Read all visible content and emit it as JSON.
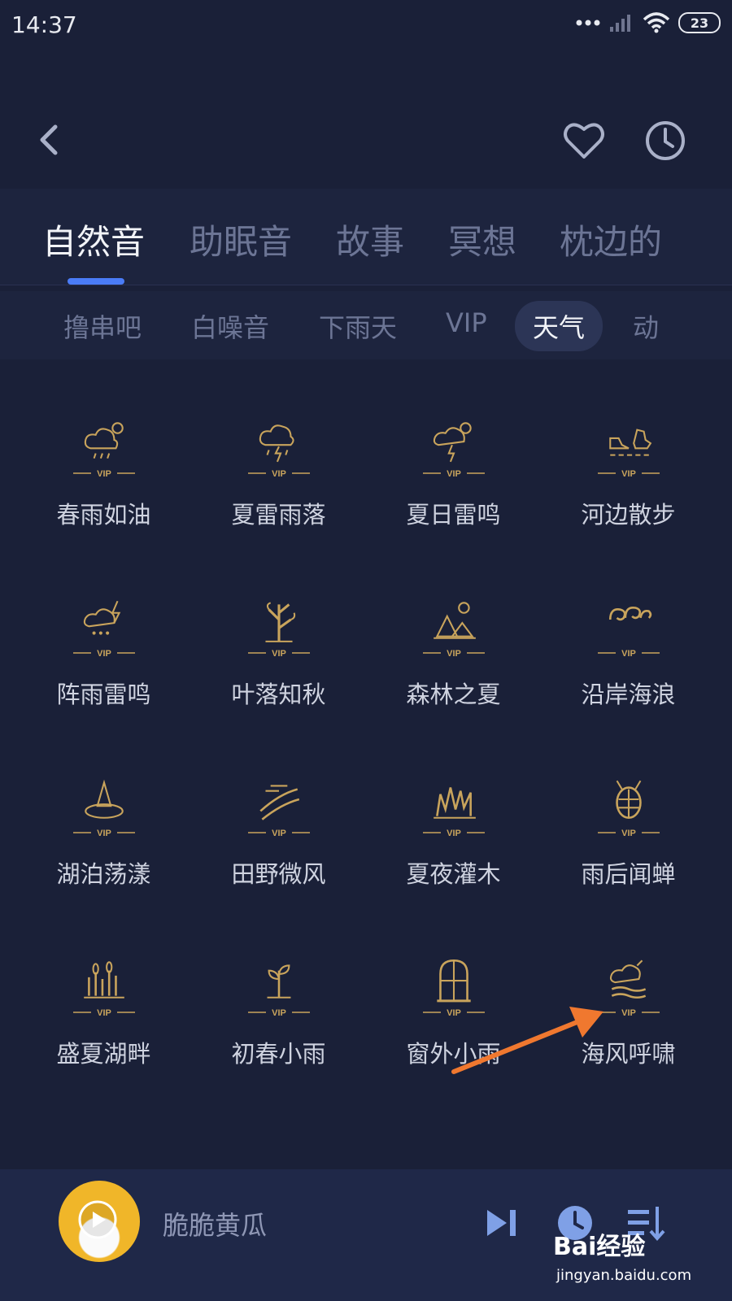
{
  "status": {
    "time": "14:37",
    "battery": "23"
  },
  "tabs": [
    {
      "label": "自然音"
    },
    {
      "label": "助眠音"
    },
    {
      "label": "故事"
    },
    {
      "label": "冥想"
    },
    {
      "label": "枕边的"
    }
  ],
  "chips": [
    {
      "label": "撸串吧"
    },
    {
      "label": "白噪音"
    },
    {
      "label": "下雨天"
    },
    {
      "label": "VIP"
    },
    {
      "label": "天气"
    },
    {
      "label": "动"
    }
  ],
  "vip_badge": "VIP",
  "sounds": [
    {
      "label": "春雨如油",
      "icon": "rain-sun-icon"
    },
    {
      "label": "夏雷雨落",
      "icon": "thunder-rain-icon"
    },
    {
      "label": "夏日雷鸣",
      "icon": "sun-thunder-icon"
    },
    {
      "label": "河边散步",
      "icon": "walking-shoes-icon"
    },
    {
      "label": "阵雨雷鸣",
      "icon": "shower-thunder-icon"
    },
    {
      "label": "叶落知秋",
      "icon": "tree-icon"
    },
    {
      "label": "森林之夏",
      "icon": "forest-camp-icon"
    },
    {
      "label": "沿岸海浪",
      "icon": "waves-icon"
    },
    {
      "label": "湖泊荡漾",
      "icon": "lake-tree-icon"
    },
    {
      "label": "田野微风",
      "icon": "field-wind-icon"
    },
    {
      "label": "夏夜灌木",
      "icon": "grass-icon"
    },
    {
      "label": "雨后闻蝉",
      "icon": "cicada-icon"
    },
    {
      "label": "盛夏湖畔",
      "icon": "reeds-icon"
    },
    {
      "label": "初春小雨",
      "icon": "sprout-icon"
    },
    {
      "label": "窗外小雨",
      "icon": "window-icon"
    },
    {
      "label": "海风呼啸",
      "icon": "sea-wind-icon"
    }
  ],
  "player": {
    "song": "脆脆黄瓜"
  },
  "watermark": {
    "logo": "Bai经验",
    "sub": "jingyan.baidu.com"
  },
  "colors": {
    "background": "#1a2038",
    "accent": "#4a7cf7",
    "gold": "#c9a45c",
    "annotation_arrow": "#f0782f"
  }
}
